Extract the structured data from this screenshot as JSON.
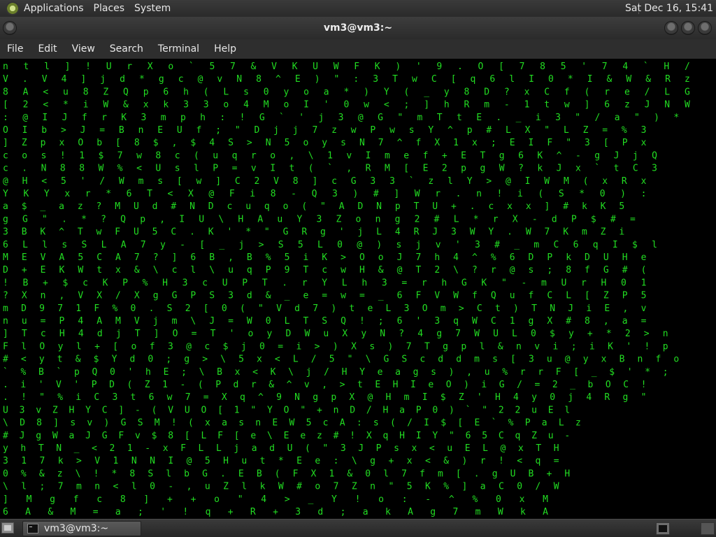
{
  "top_panel": {
    "menus": [
      "Applications",
      "Places",
      "System"
    ],
    "clock": "Sat Dec 16, 15:41"
  },
  "window": {
    "title": "vm3@vm3:~"
  },
  "menu_bar": {
    "items": [
      "File",
      "Edit",
      "View",
      "Search",
      "Terminal",
      "Help"
    ]
  },
  "terminal": {
    "fg_color": "#22dd22",
    "highlight_color": "#ffffff",
    "rows": [
      "   n   t l   ] ! U   r     X o   ` 5     7 & V K     U W F K     )     ' 9       .     O [   7 8   5   '   7       4 `     H /",
      "   V . V 4   ] j d   *     g c   @ v     N 8 ^ E     ) \" : 3     T   w C [ q   6       l I   0 *   I       &       W &     R z",
      "   8 A < u   8 Z Q   p     6 h   ( L     s 0 y o     a * ) Y     (   _ y   8   D       ? x   C f           (   r   e /     L G",
      "   [ 2 < *   i W &   x     k 3   3 o     4 M o I '     0 w <     ;   ] h   R   m       - 1   t w           ]   6   z J     N W",
      "   : @ I J   f r K   3     m p   h :     ! G ` ' j     3 @ G     \" m T   t   E       . _   i             3   \" / a \"     ) *",
      "   O I b >   J = B   n     E U   f ;     \" D j j 7     z w P     w s Y   ^ p   # L   X             \"   L   Z = %     3",
      "   ] Z p x   O b [   8     $ ,   $ 4   S > N 5 o y     s N 7     ^ f X   1 x   ; E   I             F   \"   3 [ P     x",
      "   c o s !   1 $ 7   w     8 c   ( u   q   r o , \\     1 v I     m e f   + E   T g   6             K   ^   - g J     j Q",
      "   c . N 8   8 W %         < U   s l P   =   v I t (     ` ,     R M [   E 2   p g   W   ?         k   J   x ` t     C 3",
      "   @ H < 5   ' / W m       s [   w ] C 2   V 8   ]     c G 3     3 ` z   l Y   >   @   I         W   M   ( x       R x",
      "   Y K Y x   r * 6 T       < X   @ F i 8   -   Q     3 )   #     ] W   r   . n   !   i           (   S   * 0       ) :",
      "   a $ _ a   z ? M U       d #   N D c u   q   o (   \" A   D N   p   T   U +       .         c x x ] # k       K 5",
      "   g G \" .   * ?   Q       p , I   U \\ H A   u   Y 3   Z   o n   g   2   #         L         * r X - d P $       # =",
      "   3 B K     ^ T   w       F U 5   C . K '   *   \" G   R   g ' j   L   4 R J       3   W     Y . W 7 K m       Z i",
      "   6 L l     s S   L       A 7 y   - [ _   j   > S   5   L 0 @ ) s   j   v '       3   #         _ m C 6 q   I       $ l",
      "   M   E     V A   5 C     A 7 ?   ] 6 B       , B   %   5 i K > O   o   J 7   h 4   ^         % 6 D P k   D   U   H e",
      "   D   +     E K   W t     x   &   \\ c l       \\ u   q   P   9 T c   w H & @   T 2   \\ ?       r @ s ; 8   f   G   # (",
      "   !   B     + $   c K     P   %   H 3 c       U P T   .   r   Y   L h 3     = r   h G         K \" - m U   r   H   0 1",
      "   ? X   n   , V   X /     X g G   P S 3       d & _   e   =   w   = _ 6     F V   W f       Q   u f C L   [     Z P 5",
      "   m D   9   7 1   F %     0 . S   2 [ 0       ( \" V   d   7   )   t e L 3   O m   > C       t   ) T N J   i     E , v",
      "   n u   =   P 4   A M     V j m   \\ J =         W 0   L   T   S   Q ! ; 6   ' 3   q W       C   1 g X #   8     , a =",
      "   ] T   c   H 4   d j     T ] O   = T '         o y   D   W   u   X y N ? 4   g     7 W       U   L 0 $ y   +     * 2 > n",
      "   F l   O y l +   [ o     f 3     @ c $ j       0 =   i   >   )   X s ) 7 T   g     p l       &   n v i ;   i     K ' ! p",
      "   # <   y t & $   Y d     0 ;     g > \\ 5       x <   L   /   5   \" \\ G S c d   d     m s       [   3 u @ y   x     B n f o",
      "   ` %   B ` p Q   0         ' h   E ; \\ B       x <   K   \\   j   / H Y e a g   s     ) ,   u   % r r F [ _   $     ' * ;",
      "   . i ' V '   P   D ( Z   1       - ( P       d r   &   ^   v   ,   > t E H I   e     O )   i   G / = 2 _ b   O   C !",
      "   . ! \" % i   C   3 t 6 w   7       = X       q ^ 9   N   g   p   X   @ H m I   $     Z ' H 4   y   0 j 4 R     g   \"",
      "   U 3 v Z H   Y   C ] - ( V U   O [       1 \" Y O   \"   +   n   D / H a P     0 ) ` \" 2   2 u E       l",
      "   \\ D 8 ]   s v   ) G S M ! (     x a       s n E W   5   c   A   : s ( / I     $ [ E ` %   P a L       z",
      "   # J g W   a J   G F v $ 8 [     L         F [ e \\   E e z   # ! X q H I     Y \" 6 5 C   q Z u       -",
      "     y h T   N _   < 2 1 - x F     L         L j a d   U ( \"   3 J P s x <     u E L @ x   T         H",
      "     3 1 7   k >   V 1 N N I @     5         H u t *   E e :   \\ g + x <       & ) r ! <   q         =",
      "     0 % &   z \\   ! * 8 S l b     G         . E B     ( F X   1 & 0 l 7 f   m   [ . g U B   +         H",
      "     \\ l ;   7 m   n < l 0 - ,     u         Z l k     W # o   7 Z n \" 5 K     % ] a C 0   /         W",
      "       ] M   g f   c 8   ] +       +         o \" 4     > _   Y ! o : -       ^ %   0   x           M",
      "       6 A   & M   = a ; '   ! q   +         R + 3     d ; a   k A g 7         m   W   k           A"
    ]
  }
}
